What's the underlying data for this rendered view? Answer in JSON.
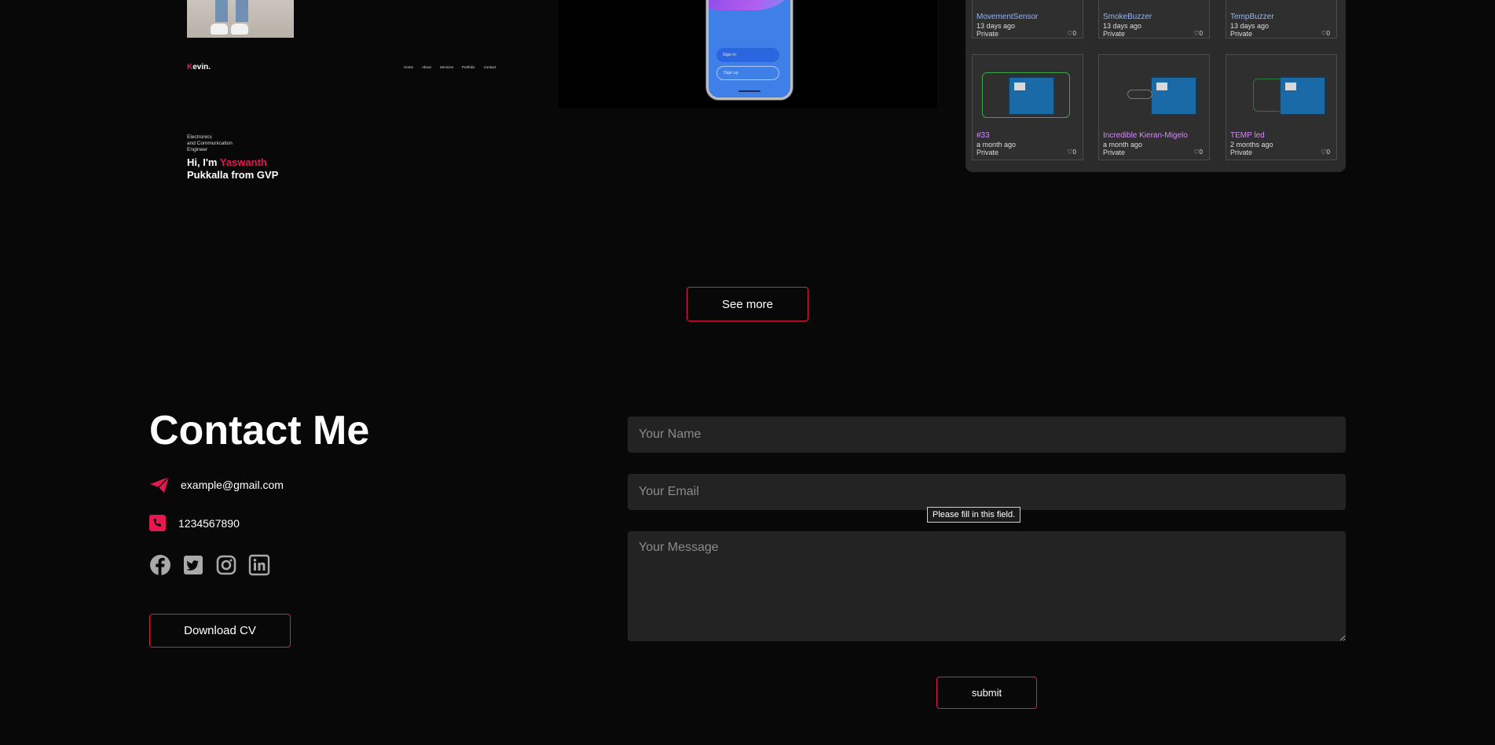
{
  "portfolio": {
    "website_preview": {
      "logo_initial": "K",
      "logo_rest": "evin.",
      "nav": [
        "Home",
        "About",
        "Services",
        "Portfolio",
        "Contact"
      ],
      "subtitle_lines": [
        "Electronics",
        "and Communication",
        "Engineer"
      ],
      "hero_prefix": "Hi, I'm ",
      "hero_name": "Yaswanth",
      "hero_rest": "Pukkalla from GVP"
    },
    "phone_preview": {
      "sign_in": "Sign in",
      "sign_up": "Sign up"
    },
    "projects": [
      {
        "name": "MovementSensor",
        "date": "13 days ago",
        "visibility": "Private",
        "likes": "0",
        "color": "#8fb4ff"
      },
      {
        "name": "SmokeBuzzer",
        "date": "13 days ago",
        "visibility": "Private",
        "likes": "0",
        "color": "#8fb4ff"
      },
      {
        "name": "TempBuzzer",
        "date": "13 days ago",
        "visibility": "Private",
        "likes": "0",
        "color": "#8fb4ff"
      },
      {
        "name": "#33",
        "date": "a month ago",
        "visibility": "Private",
        "likes": "0",
        "color": "#d887ff"
      },
      {
        "name": "Incredible Kieran-Migelo",
        "date": "a month ago",
        "visibility": "Private",
        "likes": "0",
        "color": "#d887ff"
      },
      {
        "name": "TEMP led",
        "date": "2 months ago",
        "visibility": "Private",
        "likes": "0",
        "color": "#d887ff"
      }
    ],
    "see_more_label": "See more"
  },
  "contact": {
    "title": "Contact Me",
    "email": "example@gmail.com",
    "phone": "1234567890",
    "socials": [
      "facebook-icon",
      "twitter-icon",
      "instagram-icon",
      "linkedin-icon"
    ],
    "download_cv_label": "Download CV",
    "form": {
      "name_placeholder": "Your Name",
      "email_placeholder": "Your Email",
      "message_placeholder": "Your Message",
      "submit_label": "submit",
      "validation_tooltip": "Please fill in this field."
    }
  },
  "colors": {
    "accent": "#e8174f",
    "background": "#080808",
    "field_background": "#232323"
  }
}
